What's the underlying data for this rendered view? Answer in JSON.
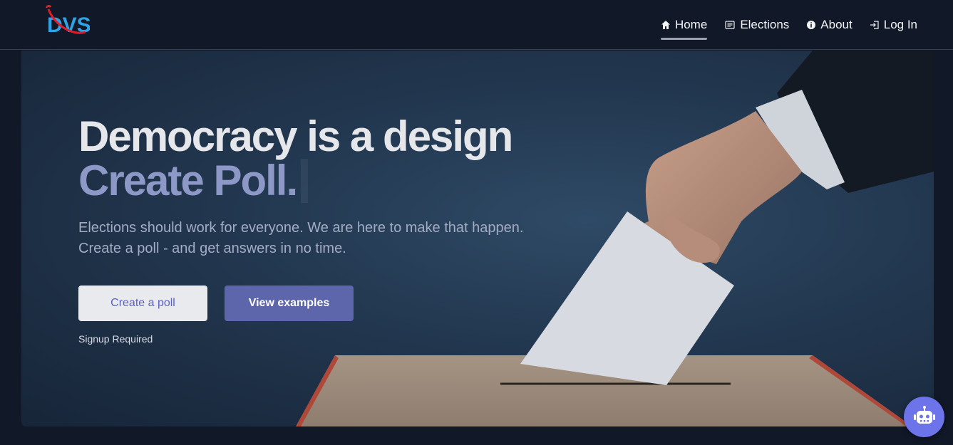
{
  "brand": {
    "logo_text": "DVS",
    "logo_icon": "dvs-logo"
  },
  "nav": [
    {
      "label": "Home",
      "icon": "home-icon",
      "active": true
    },
    {
      "label": "Elections",
      "icon": "list-icon",
      "active": false
    },
    {
      "label": "About",
      "icon": "info-icon",
      "active": false
    },
    {
      "label": "Log In",
      "icon": "login-icon",
      "active": false
    }
  ],
  "hero": {
    "title_line1": "Democracy is a design",
    "title_line2": "Create Poll.",
    "subtitle_line1": "Elections should work for everyone. We are here to make that happen.",
    "subtitle_line2": "Create a poll - and get answers in no time.",
    "primary_button": "Create a poll",
    "secondary_button": "View examples",
    "note": "Signup Required"
  },
  "chatbot": {
    "icon": "robot-icon"
  },
  "colors": {
    "background": "#111827",
    "accent": "#5d66ab",
    "headline": "#e5e7eb",
    "headline_accent": "#8e98c6"
  }
}
